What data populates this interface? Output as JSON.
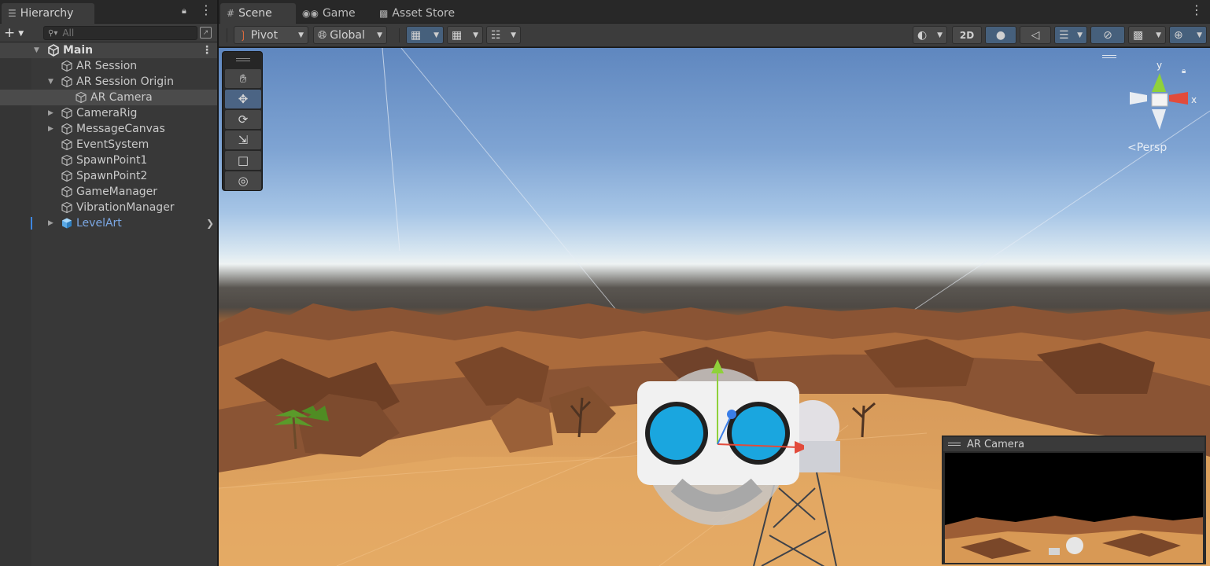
{
  "hierarchy": {
    "tab_label": "Hierarchy",
    "search_placeholder": "All",
    "scene_name": "Main",
    "items": [
      {
        "label": "AR Session"
      },
      {
        "label": "AR Session Origin"
      },
      {
        "label": "AR Camera"
      },
      {
        "label": "CameraRig"
      },
      {
        "label": "MessageCanvas"
      },
      {
        "label": "EventSystem"
      },
      {
        "label": "SpawnPoint1"
      },
      {
        "label": "SpawnPoint2"
      },
      {
        "label": "GameManager"
      },
      {
        "label": "VibrationManager"
      },
      {
        "label": "LevelArt"
      }
    ]
  },
  "tabs": {
    "scene": "Scene",
    "game": "Game",
    "asset_store": "Asset Store"
  },
  "toolbar": {
    "pivot": "Pivot",
    "global": "Global",
    "two_d": "2D"
  },
  "viewport": {
    "gizmo_y": "y",
    "gizmo_x": "x",
    "projection": "Persp"
  },
  "camera_preview": {
    "title": "AR Camera"
  },
  "colors": {
    "selection": "#4b4b4b",
    "prefab_text": "#7ba7e3",
    "toolbar_active": "#46607c",
    "gizmo_x": "#e24b3b",
    "gizmo_y": "#8fd13a"
  },
  "icons": {
    "hierarchy": "list-icon",
    "scene": "grid-icon",
    "game": "gamepad-icon",
    "asset_store": "bag-icon"
  }
}
